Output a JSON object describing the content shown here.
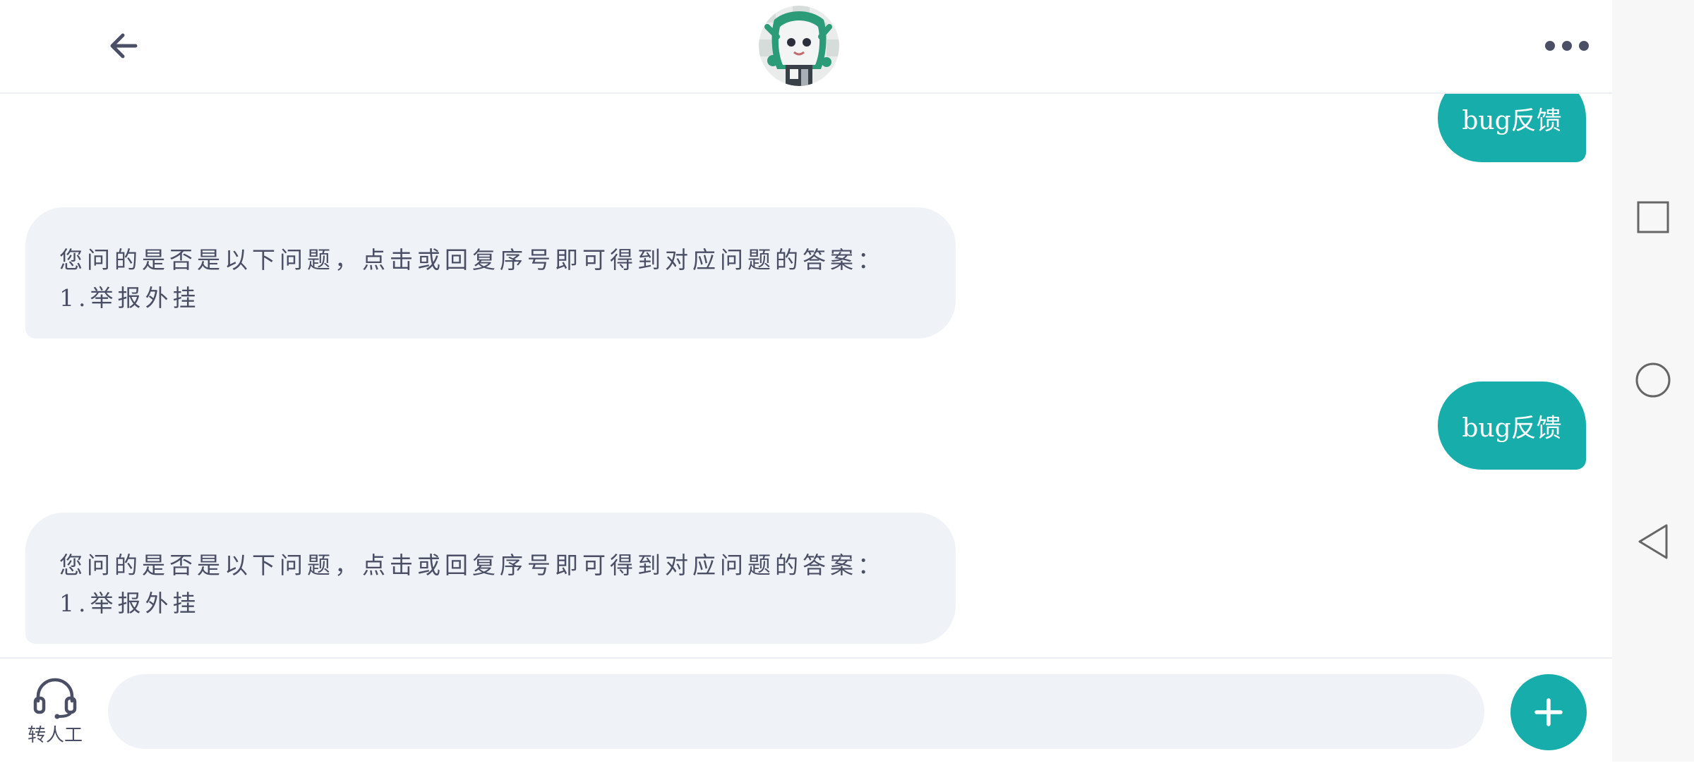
{
  "header": {
    "back_icon": "arrow-left-icon",
    "avatar_icon": "bot-avatar",
    "more_icon": "more-dots-icon"
  },
  "messages": [
    {
      "direction": "out",
      "text": "bug反馈"
    },
    {
      "direction": "in",
      "intro": "您问的是否是以下问题，点击或回复序号即可得到对应问题的答案：",
      "options": [
        "1.举报外挂"
      ]
    },
    {
      "direction": "out",
      "text": "bug反馈"
    },
    {
      "direction": "in",
      "intro": "您问的是否是以下问题，点击或回复序号即可得到对应问题的答案：",
      "options": [
        "1.举报外挂"
      ]
    }
  ],
  "bottom": {
    "human_label": "转人工",
    "input_value": "",
    "input_placeholder": "",
    "plus_icon": "plus-icon"
  },
  "system_nav": {
    "recents_icon": "square-icon",
    "home_icon": "circle-icon",
    "back_icon": "triangle-back-icon"
  },
  "colors": {
    "accent": "#16adab",
    "bubble_in": "#eff2f6",
    "text": "#4a4f66"
  }
}
